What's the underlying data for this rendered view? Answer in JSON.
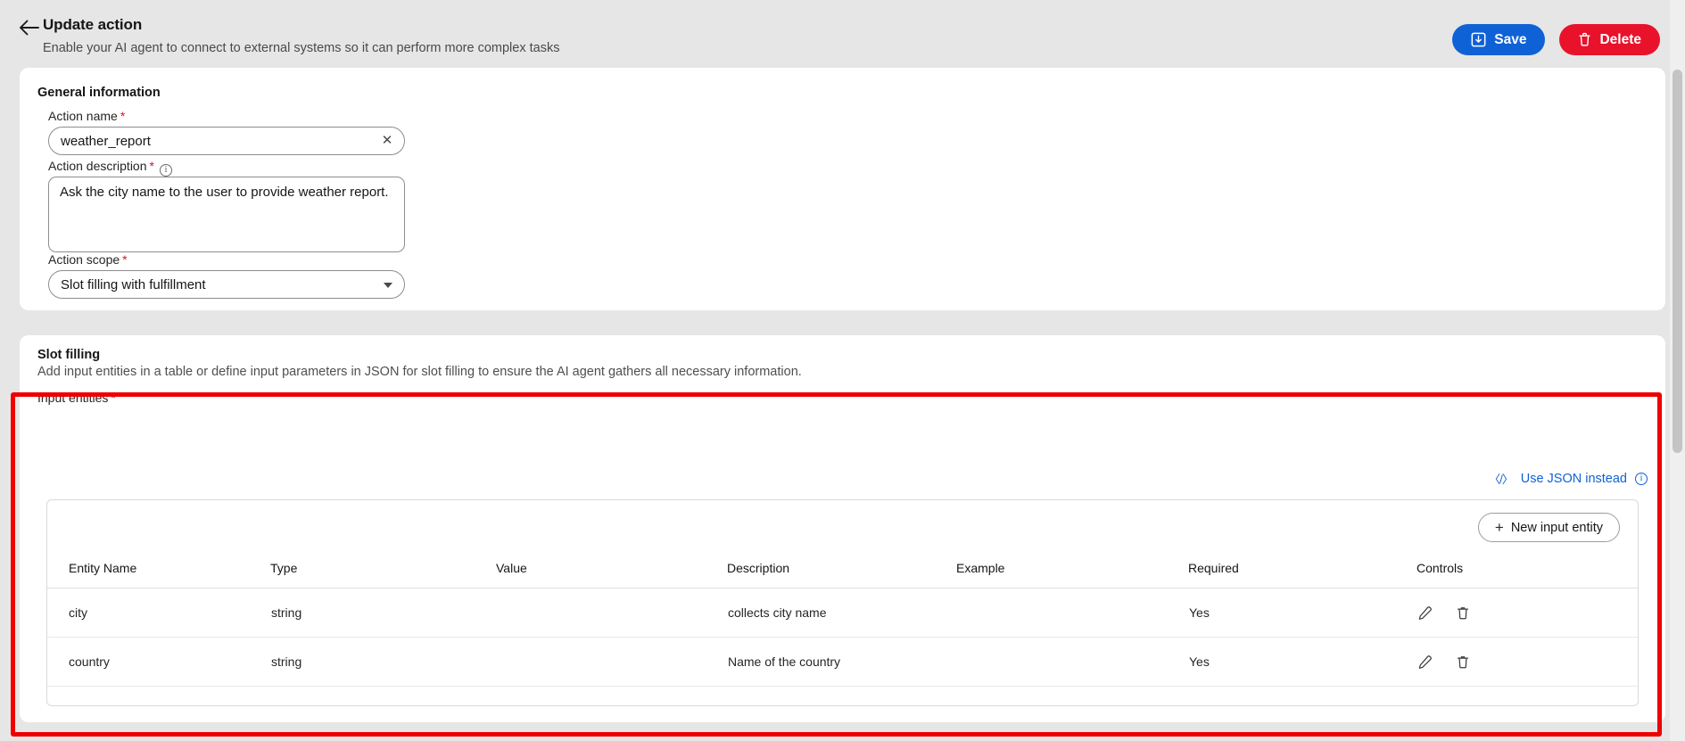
{
  "header": {
    "back_icon": "arrow-left-icon",
    "title": "Update action",
    "subtitle": "Enable your AI agent to connect to external systems so it can perform more complex tasks",
    "save_label": "Save",
    "save_icon": "save-disk-icon",
    "delete_label": "Delete",
    "delete_icon": "trash-icon",
    "save_color": "#0f62d6",
    "delete_color": "#e8132b"
  },
  "general": {
    "section_title": "General information",
    "action_name": {
      "label": "Action name",
      "required_mark": "*",
      "value": "weather_report",
      "placeholder": "",
      "clear_icon": "close-icon"
    },
    "action_description": {
      "label": "Action description",
      "required_mark": "*",
      "info_icon": "info-icon",
      "value": "Ask the city name to the user to provide weather report.",
      "placeholder": ""
    },
    "action_scope": {
      "label": "Action scope",
      "required_mark": "*",
      "value": "Slot filling with fulfillment",
      "caret_icon": "chevron-down-icon"
    }
  },
  "slot_filling": {
    "section_title": "Slot filling",
    "section_desc": "Add input entities in a table or define input parameters in JSON for slot filling to ensure the AI agent gathers all necessary information.",
    "input_entities_label": "Input entities",
    "required_mark": "*",
    "use_json": {
      "code_icon": "code-icon",
      "label": "Use JSON instead",
      "info_icon": "info-icon",
      "color": "#0f62d6"
    },
    "new_entity_button": {
      "plus_icon": "plus-icon",
      "label": "New input entity"
    },
    "table": {
      "columns": [
        "Entity Name",
        "Type",
        "Value",
        "Description",
        "Example",
        "Required",
        "Controls"
      ],
      "rows": [
        {
          "entity_name": "city",
          "type": "string",
          "value": "",
          "description": "collects city name",
          "example": "",
          "required": "Yes",
          "edit_icon": "pencil-icon",
          "delete_icon": "trash-icon"
        },
        {
          "entity_name": "country",
          "type": "string",
          "value": "",
          "description": "Name of the country",
          "example": "",
          "required": "Yes",
          "edit_icon": "pencil-icon",
          "delete_icon": "trash-icon"
        }
      ]
    },
    "highlight_color": "#ee0000"
  }
}
